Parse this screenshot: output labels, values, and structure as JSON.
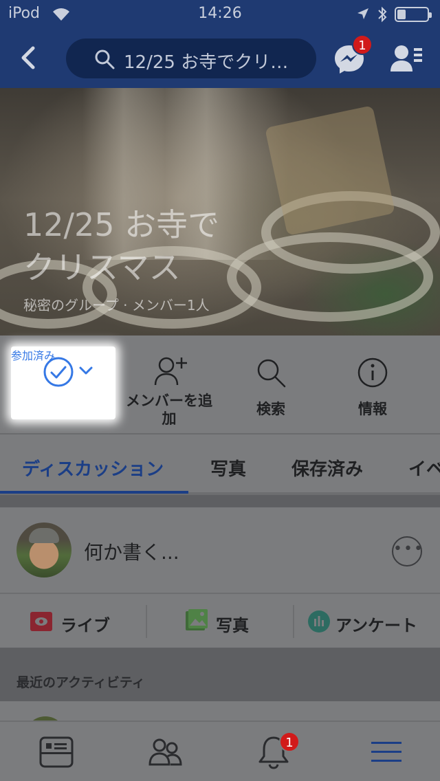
{
  "status_bar": {
    "carrier": "iPod",
    "time": "14:26"
  },
  "nav": {
    "search_text": "12/25 お寺でクリ…",
    "messenger_badge": "1",
    "icons": [
      "back-icon",
      "search-icon",
      "messenger-icon",
      "friend-requests-icon"
    ]
  },
  "group": {
    "title_line1": "12/25 お寺で",
    "title_line2": "クリスマス",
    "subtitle": "秘密のグループ · メンバー1人"
  },
  "actions": [
    {
      "label": "参加済み",
      "icon": "check-circle-icon"
    },
    {
      "label": "メンバーを追加",
      "icon": "add-person-icon"
    },
    {
      "label": "検索",
      "icon": "search-icon"
    },
    {
      "label": "情報",
      "icon": "info-icon"
    }
  ],
  "tabs": [
    {
      "label": "ディスカッション",
      "active": true
    },
    {
      "label": "写真"
    },
    {
      "label": "保存済み"
    },
    {
      "label": "イベ"
    }
  ],
  "composer": {
    "placeholder": "何か書く..."
  },
  "post_options": [
    {
      "label": "ライブ",
      "icon": "live-video-icon",
      "color": "#e5293a"
    },
    {
      "label": "写真",
      "icon": "photo-icon",
      "color": "#53b04b"
    },
    {
      "label": "アンケート",
      "icon": "poll-icon",
      "color": "#35a38e"
    }
  ],
  "recent_activity": "最近のアクティビティ",
  "bottom_tabs": {
    "notifications_badge": "1",
    "icons": [
      "news-feed-icon",
      "groups-icon",
      "notifications-icon",
      "menu-icon"
    ]
  },
  "colors": {
    "nav_bg": "#1f3a72",
    "accent": "#3578e5",
    "active_tab": "#1b3e86",
    "badge": "#d11a1a"
  }
}
